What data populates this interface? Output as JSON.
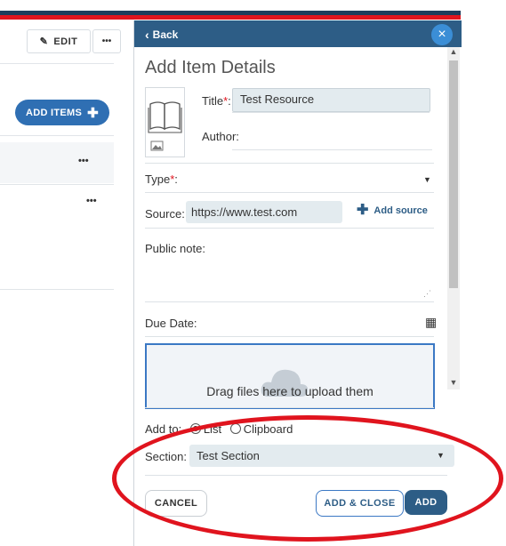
{
  "left_panel": {
    "edit_label": "EDIT",
    "more_label": "•••",
    "add_items_label": "ADD ITEMS",
    "row1_more": "•••",
    "row2_more": "•••"
  },
  "modal": {
    "back_label": "Back",
    "heading": "Add Item Details",
    "title_label": "Title",
    "title_value": "Test Resource",
    "author_label": "Author:",
    "type_label": "Type",
    "source_label": "Source:",
    "source_value": "https://www.test.com",
    "add_source_label": "Add source",
    "public_note_label": "Public note:",
    "due_date_label": "Due Date:",
    "dropzone_text": "Drag files here to upload them",
    "add_to_label": "Add to:",
    "add_to_options": [
      "List",
      "Clipboard"
    ],
    "add_to_selected": "List",
    "section_label": "Section:",
    "section_value": "Test Section",
    "cancel_label": "CANCEL",
    "add_close_label": "ADD & CLOSE",
    "add_label": "ADD"
  },
  "colors": {
    "header": "#2d5d86",
    "accent": "#3b78c4",
    "annotation_red": "#e0141e"
  }
}
